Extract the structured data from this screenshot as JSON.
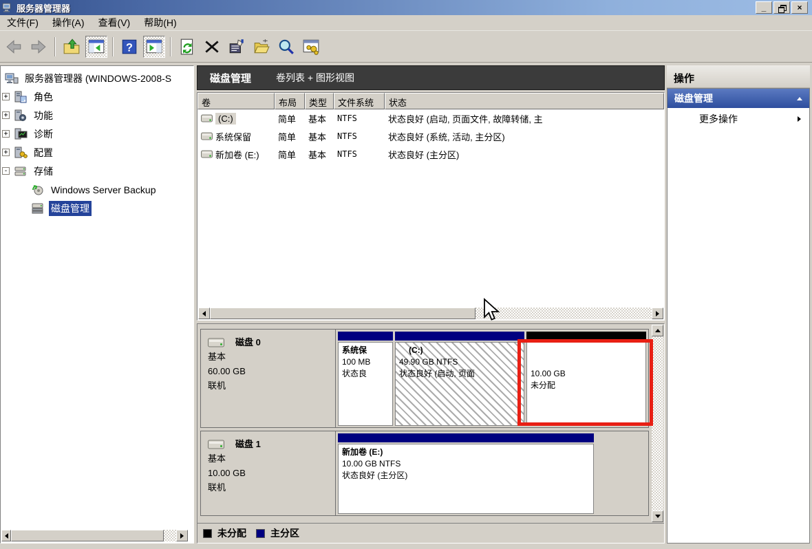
{
  "window": {
    "title": "服务器管理器",
    "controls": {
      "minimize": "_",
      "close": "×"
    }
  },
  "menu": {
    "items": [
      {
        "label": "文件(F)"
      },
      {
        "label": "操作(A)"
      },
      {
        "label": "查看(V)"
      },
      {
        "label": "帮助(H)"
      }
    ]
  },
  "toolbar": {
    "icons": [
      "back-icon",
      "forward-icon",
      "up-folder-icon",
      "console-tree-icon",
      "help-icon",
      "action-pane-icon",
      "refresh-icon",
      "delete-icon",
      "properties-icon",
      "open-folder-icon",
      "search-icon",
      "views-icon"
    ]
  },
  "tree": {
    "root": {
      "label": "服务器管理器 (WINDOWS-2008-S"
    },
    "items": [
      {
        "expander": "+",
        "label": "角色"
      },
      {
        "expander": "+",
        "label": "功能"
      },
      {
        "expander": "+",
        "label": "诊断"
      },
      {
        "expander": "+",
        "label": "配置"
      },
      {
        "expander": "-",
        "label": "存储"
      },
      {
        "label": "Windows Server Backup"
      },
      {
        "label": "磁盘管理",
        "selected": true
      }
    ]
  },
  "main": {
    "header": {
      "title": "磁盘管理",
      "subtitle": "卷列表 + 图形视图"
    },
    "volume_table": {
      "columns": [
        "卷",
        "布局",
        "类型",
        "文件系统",
        "状态"
      ],
      "rows": [
        {
          "name": "(C:)",
          "layout": "简单",
          "type": "基本",
          "fs": "NTFS",
          "status": "状态良好 (启动, 页面文件, 故障转储, 主"
        },
        {
          "name": "系统保留",
          "layout": "简单",
          "type": "基本",
          "fs": "NTFS",
          "status": "状态良好 (系统, 活动, 主分区)"
        },
        {
          "name": "新加卷 (E:)",
          "layout": "简单",
          "type": "基本",
          "fs": "NTFS",
          "status": "状态良好 (主分区)"
        }
      ]
    },
    "disks": [
      {
        "name": "磁盘 0",
        "type": "基本",
        "size": "60.00 GB",
        "status": "联机",
        "partitions": [
          {
            "title": "系统保",
            "line2": "100 MB",
            "line3": "状态良"
          },
          {
            "title": "(C:)",
            "line2": "49.90 GB NTFS",
            "line3": "状态良好 (启动, 页面"
          },
          {
            "title": "",
            "line2": "10.00 GB",
            "line3": "未分配"
          }
        ]
      },
      {
        "name": "磁盘 1",
        "type": "基本",
        "size": "10.00 GB",
        "status": "联机",
        "partitions": [
          {
            "title": "新加卷 (E:)",
            "line2": "10.00 GB NTFS",
            "line3": "状态良好 (主分区)"
          }
        ]
      }
    ],
    "legend": [
      {
        "label": "未分配",
        "color": "#000000"
      },
      {
        "label": "主分区",
        "color": "#000080"
      }
    ]
  },
  "actions": {
    "title": "操作",
    "section_label": "磁盘管理",
    "more_label": "更多操作"
  },
  "annotation": {
    "type": "red-rectangle",
    "color": "#e81f14",
    "target": "unallocated-partition-disk0"
  },
  "colors": {
    "titlebar_left": "#33508c",
    "titlebar_right": "#9dbce4",
    "chrome": "#d4d0c8",
    "dark_header": "#3b3b3b",
    "primary_partition": "#000080",
    "unallocated": "#000000",
    "tree_selection": "#24439a",
    "actions_section_top": "#5b7ac1",
    "actions_section_bottom": "#2e4e9e"
  }
}
